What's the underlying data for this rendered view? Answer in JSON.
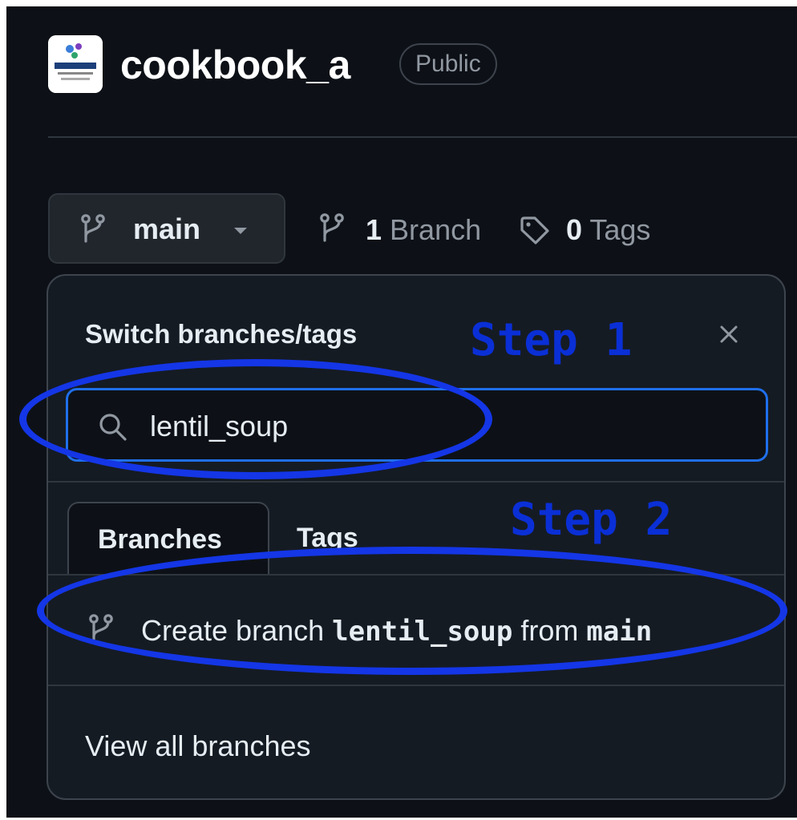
{
  "repo": {
    "name": "cookbook_a",
    "visibility": "Public",
    "avatar_icon": "org-logo-icon"
  },
  "branch_selector": {
    "current": "main",
    "icon": "git-branch-icon"
  },
  "counts": {
    "branch_number": "1",
    "branch_label": "Branch",
    "tag_number": "0",
    "tag_label": "Tags"
  },
  "dropdown": {
    "title": "Switch branches/tags",
    "search_value": "lentil_soup",
    "tabs": [
      "Branches",
      "Tags"
    ],
    "active_tab": "Branches",
    "create_prefix": "Create branch",
    "create_branch": "lentil_soup",
    "create_from": "from",
    "create_source": "main",
    "view_all": "View all branches"
  },
  "annotations": {
    "step1": "Step 1",
    "step2": "Step 2"
  },
  "colors": {
    "background": "#0d1117",
    "panel": "#151b23",
    "focus": "#1f6feb",
    "annotation": "#1436e6"
  }
}
